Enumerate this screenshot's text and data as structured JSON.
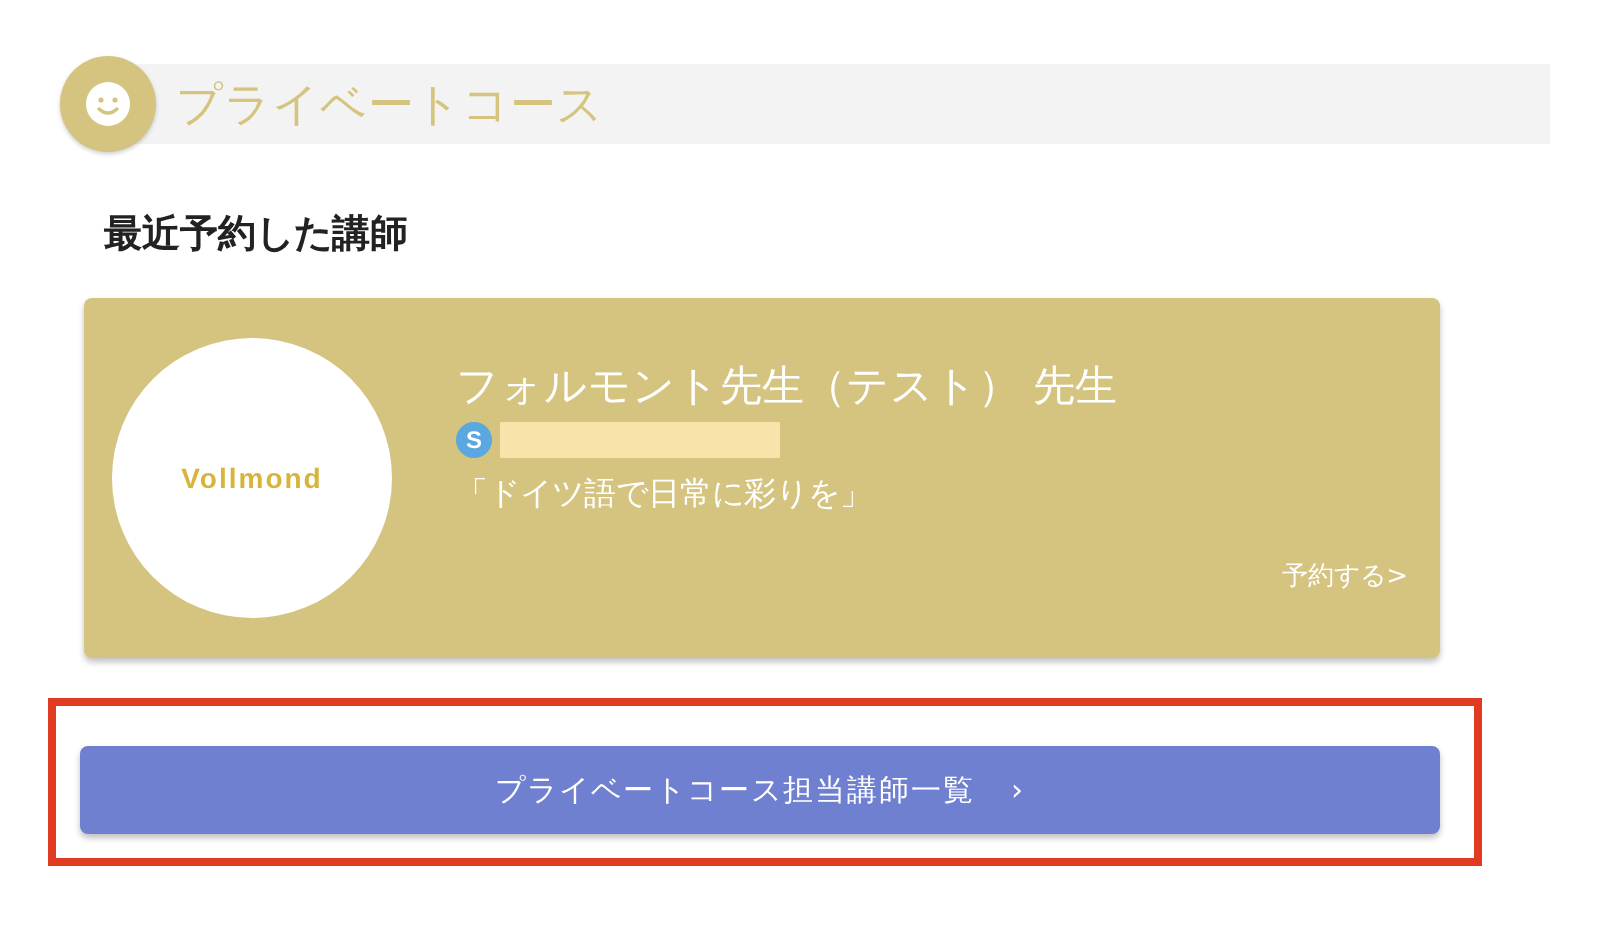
{
  "section_header": {
    "title": "プライベートコース"
  },
  "recent_heading": "最近予約した講師",
  "teacher_card": {
    "logo_text": "Vollmond",
    "name": "フォルモント先生（テスト） 先生",
    "contact_badge": "S",
    "tagline": "「ドイツ語で日常に彩りを」",
    "book_link": "予約する>"
  },
  "teacher_list_button": {
    "label": "プライベートコース担当講師一覧",
    "chevron": "›",
    "highlighted": true
  }
}
